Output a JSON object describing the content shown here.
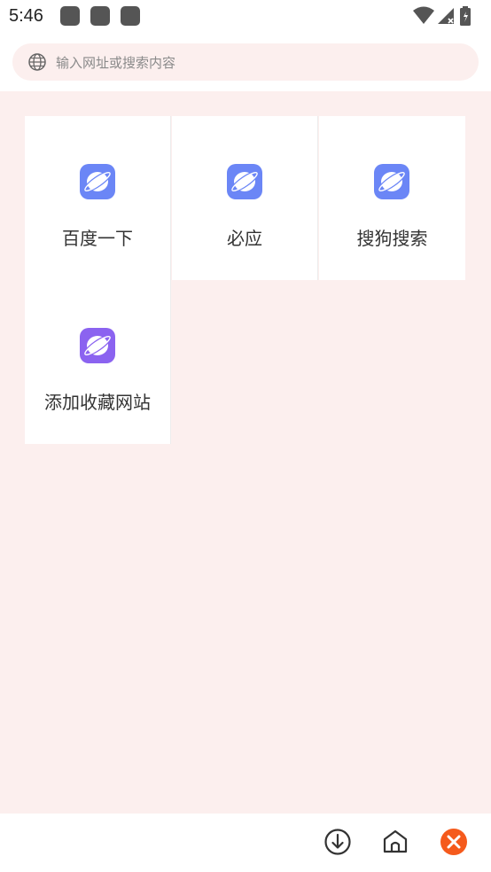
{
  "status_bar": {
    "time": "5:46"
  },
  "search": {
    "placeholder": "输入网址或搜索内容"
  },
  "tiles": [
    {
      "label": "百度一下",
      "icon": "planet-icon",
      "color": "#6b86f6"
    },
    {
      "label": "必应",
      "icon": "planet-icon",
      "color": "#6b86f6"
    },
    {
      "label": "搜狗搜索",
      "icon": "planet-icon",
      "color": "#6b86f6"
    },
    {
      "label": "添加收藏网站",
      "icon": "planet-icon",
      "color": "#8b63f0"
    }
  ],
  "bottom_bar": {
    "icons": [
      "download-icon",
      "home-icon",
      "close-icon"
    ],
    "close_color": "#f55a1c"
  },
  "colors": {
    "background": "#fcefee",
    "tile_background": "#ffffff"
  }
}
